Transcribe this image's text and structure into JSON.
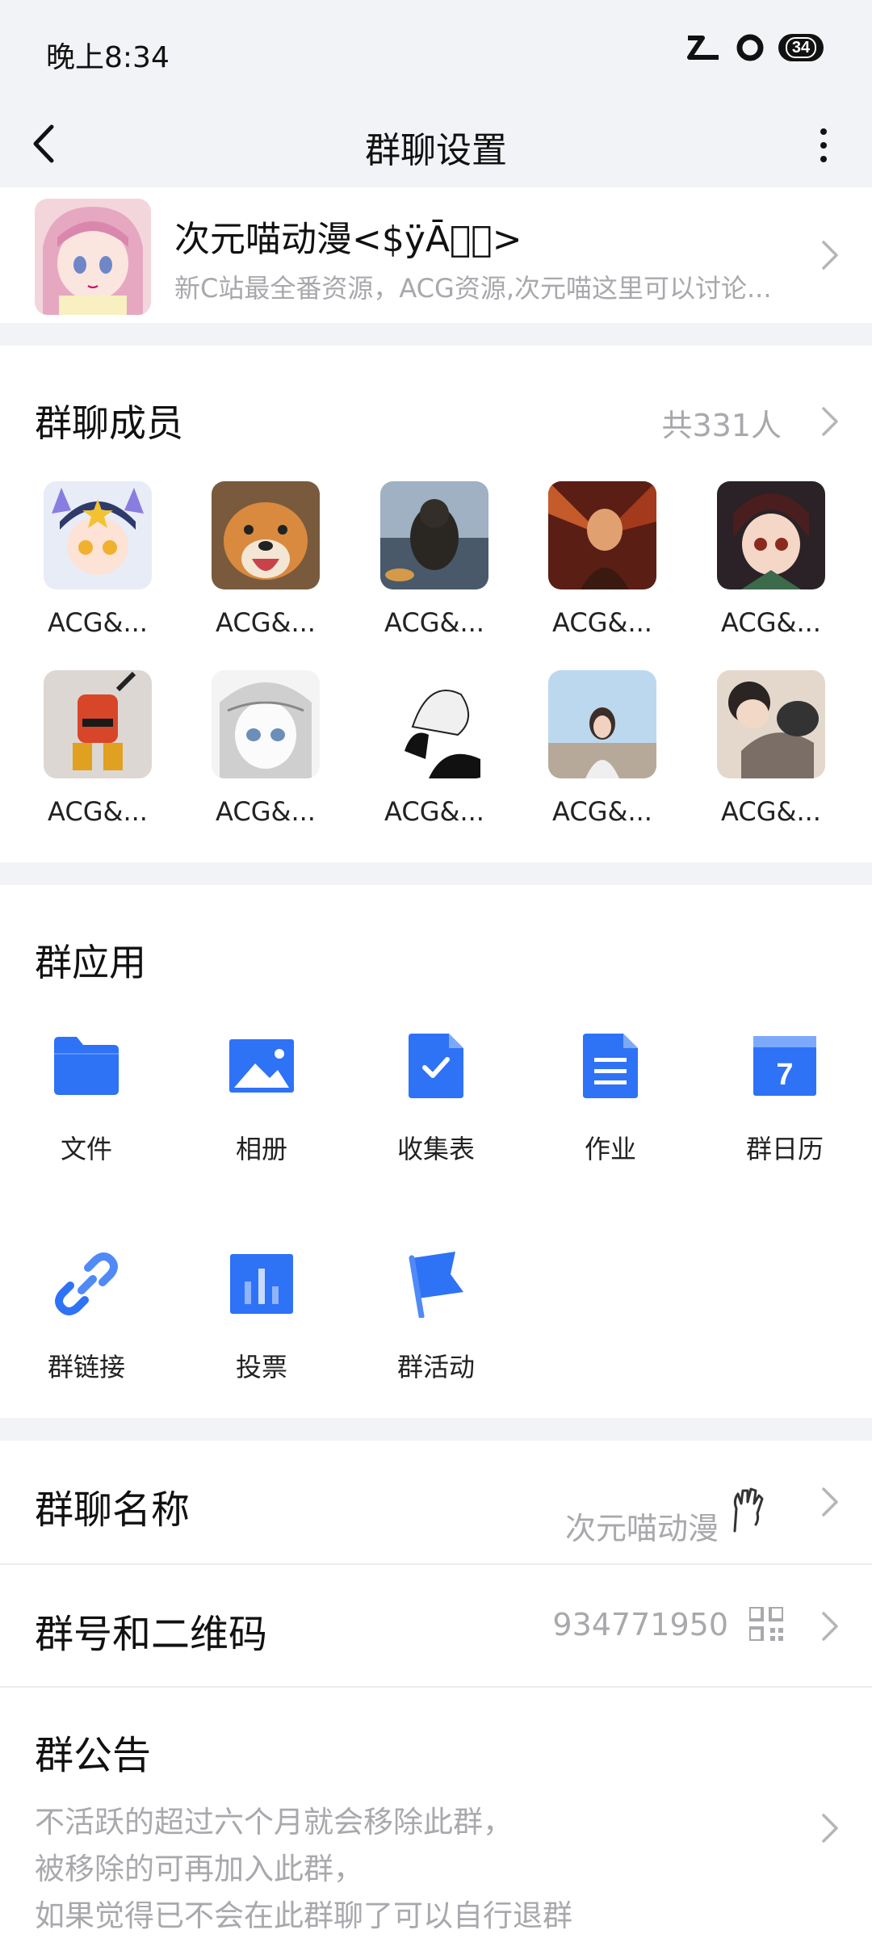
{
  "status": {
    "time": "晚上8:34",
    "battery": "34"
  },
  "nav": {
    "title": "群聊设置"
  },
  "group": {
    "name": "次元喵动漫<$ÿĀ\u0000\u0000>",
    "description": "新C站最全番资源，ACG资源,次元喵这里可以讨论..."
  },
  "members": {
    "title": "群聊成员",
    "count": "共331人",
    "items": [
      {
        "name": "ACG&..."
      },
      {
        "name": "ACG&..."
      },
      {
        "name": "ACG&..."
      },
      {
        "name": "ACG&..."
      },
      {
        "name": "ACG&..."
      },
      {
        "name": "ACG&..."
      },
      {
        "name": "ACG&..."
      },
      {
        "name": "ACG&..."
      },
      {
        "name": "ACG&..."
      },
      {
        "name": "ACG&..."
      }
    ]
  },
  "apps": {
    "title": "群应用",
    "items": [
      {
        "label": "文件",
        "icon": "folder-icon"
      },
      {
        "label": "相册",
        "icon": "photo-album-icon"
      },
      {
        "label": "收集表",
        "icon": "form-check-icon"
      },
      {
        "label": "作业",
        "icon": "document-icon"
      },
      {
        "label": "群日历",
        "icon": "calendar-icon"
      },
      {
        "label": "群链接",
        "icon": "link-icon"
      },
      {
        "label": "投票",
        "icon": "bar-chart-icon"
      },
      {
        "label": "群活动",
        "icon": "flag-icon"
      }
    ]
  },
  "settings": {
    "group_name_label": "群聊名称",
    "group_name_value": "次元喵动漫",
    "group_number_label": "群号和二维码",
    "group_number_value": "934771950",
    "notice_label": "群公告",
    "notice_lines": [
      "不活跃的超过六个月就会移除此群，",
      "被移除的可再加入此群，",
      "如果觉得已不会在此群聊了可以自行退群"
    ]
  },
  "colors": {
    "accent": "#2e72f6",
    "muted_text": "#a8a8ad",
    "background": "#f2f3f6"
  }
}
